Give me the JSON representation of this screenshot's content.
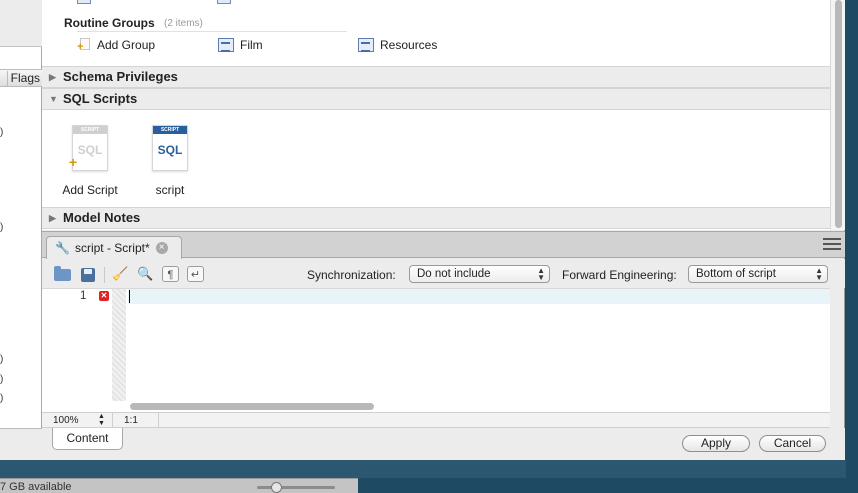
{
  "background_window": {
    "flags_header": "Flags",
    "paren_marks": [
      ")",
      ")",
      ")",
      ")",
      ")"
    ],
    "footer_text": "7 GB available"
  },
  "overview": {
    "routine_groups": {
      "title": "Routine Groups",
      "count": "(2 items)",
      "items": [
        {
          "label": "Add Group",
          "icon": "add-group-icon"
        },
        {
          "label": "Film",
          "icon": "routine-group-icon"
        },
        {
          "label": "Resources",
          "icon": "routine-group-icon"
        }
      ]
    },
    "sections": {
      "schema_privileges": "Schema Privileges",
      "sql_scripts": "SQL Scripts",
      "model_notes": "Model Notes"
    },
    "scripts": [
      {
        "label": "Add Script",
        "badge": "SCRIPT",
        "doc_text": "SQL"
      },
      {
        "label": "script",
        "badge": "SCRIPT",
        "doc_text": "SQL"
      }
    ]
  },
  "editor": {
    "tab_title": "script - Script*",
    "toolbar": {
      "sync_label": "Synchronization:",
      "sync_value": "Do not include",
      "forward_label": "Forward Engineering:",
      "forward_value": "Bottom of script"
    },
    "line_numbers": [
      "1"
    ],
    "status": {
      "zoom": "100%",
      "position": "1:1"
    },
    "content_tab": "Content",
    "buttons": {
      "apply": "Apply",
      "cancel": "Cancel"
    }
  },
  "colors": {
    "desktop": "#1f4a63",
    "error": "#dd2222",
    "accent_blue": "#2a5f9e",
    "current_line": "#e8f4f7"
  }
}
